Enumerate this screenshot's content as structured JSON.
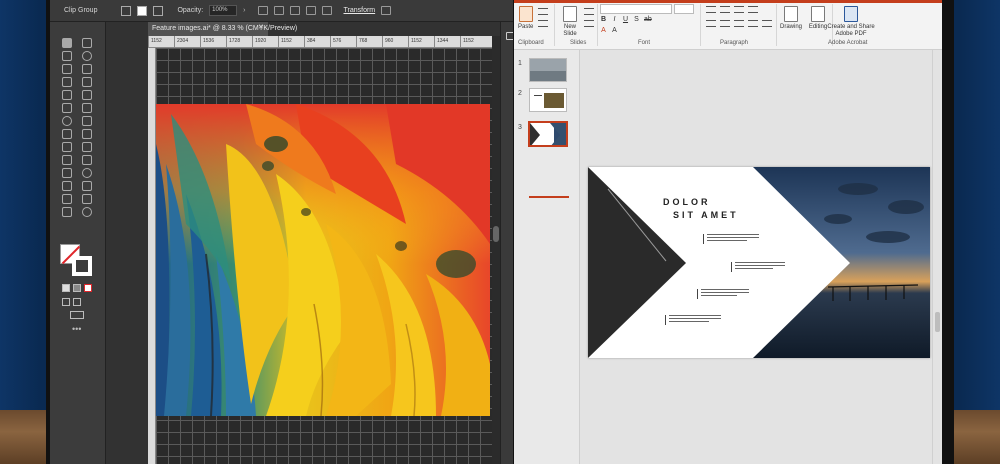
{
  "illustrator": {
    "control_bar": {
      "selection": "Clip Group",
      "opacity_label": "Opacity:",
      "opacity_value": "100%",
      "transform_label": "Transform"
    },
    "document_tab": "Feature images.ai* @ 8.33 % (CMYK/Preview)",
    "ruler_ticks": [
      "1152",
      "2304",
      "1536",
      "1728",
      "1920",
      "1152",
      "384",
      "576",
      "768",
      "960",
      "1152",
      "1344",
      "1152"
    ],
    "artwork": "macaw-feather-photo"
  },
  "powerpoint": {
    "accent_color": "#c43e1c",
    "ribbon": {
      "paste_label": "Paste",
      "new_slide_label": "New Slide",
      "drawing_label": "Drawing",
      "editing_label": "Editing",
      "create_share_label": "Create and Share Adobe PDF",
      "groups": {
        "clipboard": "Clipboard",
        "slides": "Slides",
        "font": "Font",
        "paragraph": "Paragraph",
        "acrobat": "Adobe Acrobat"
      }
    },
    "thumbnails": [
      {
        "number": "1",
        "selected": false
      },
      {
        "number": "2",
        "selected": false
      },
      {
        "number": "3",
        "selected": true
      }
    ],
    "slide": {
      "title_line1": "DOLOR",
      "title_line2": "SIT AMET"
    }
  }
}
